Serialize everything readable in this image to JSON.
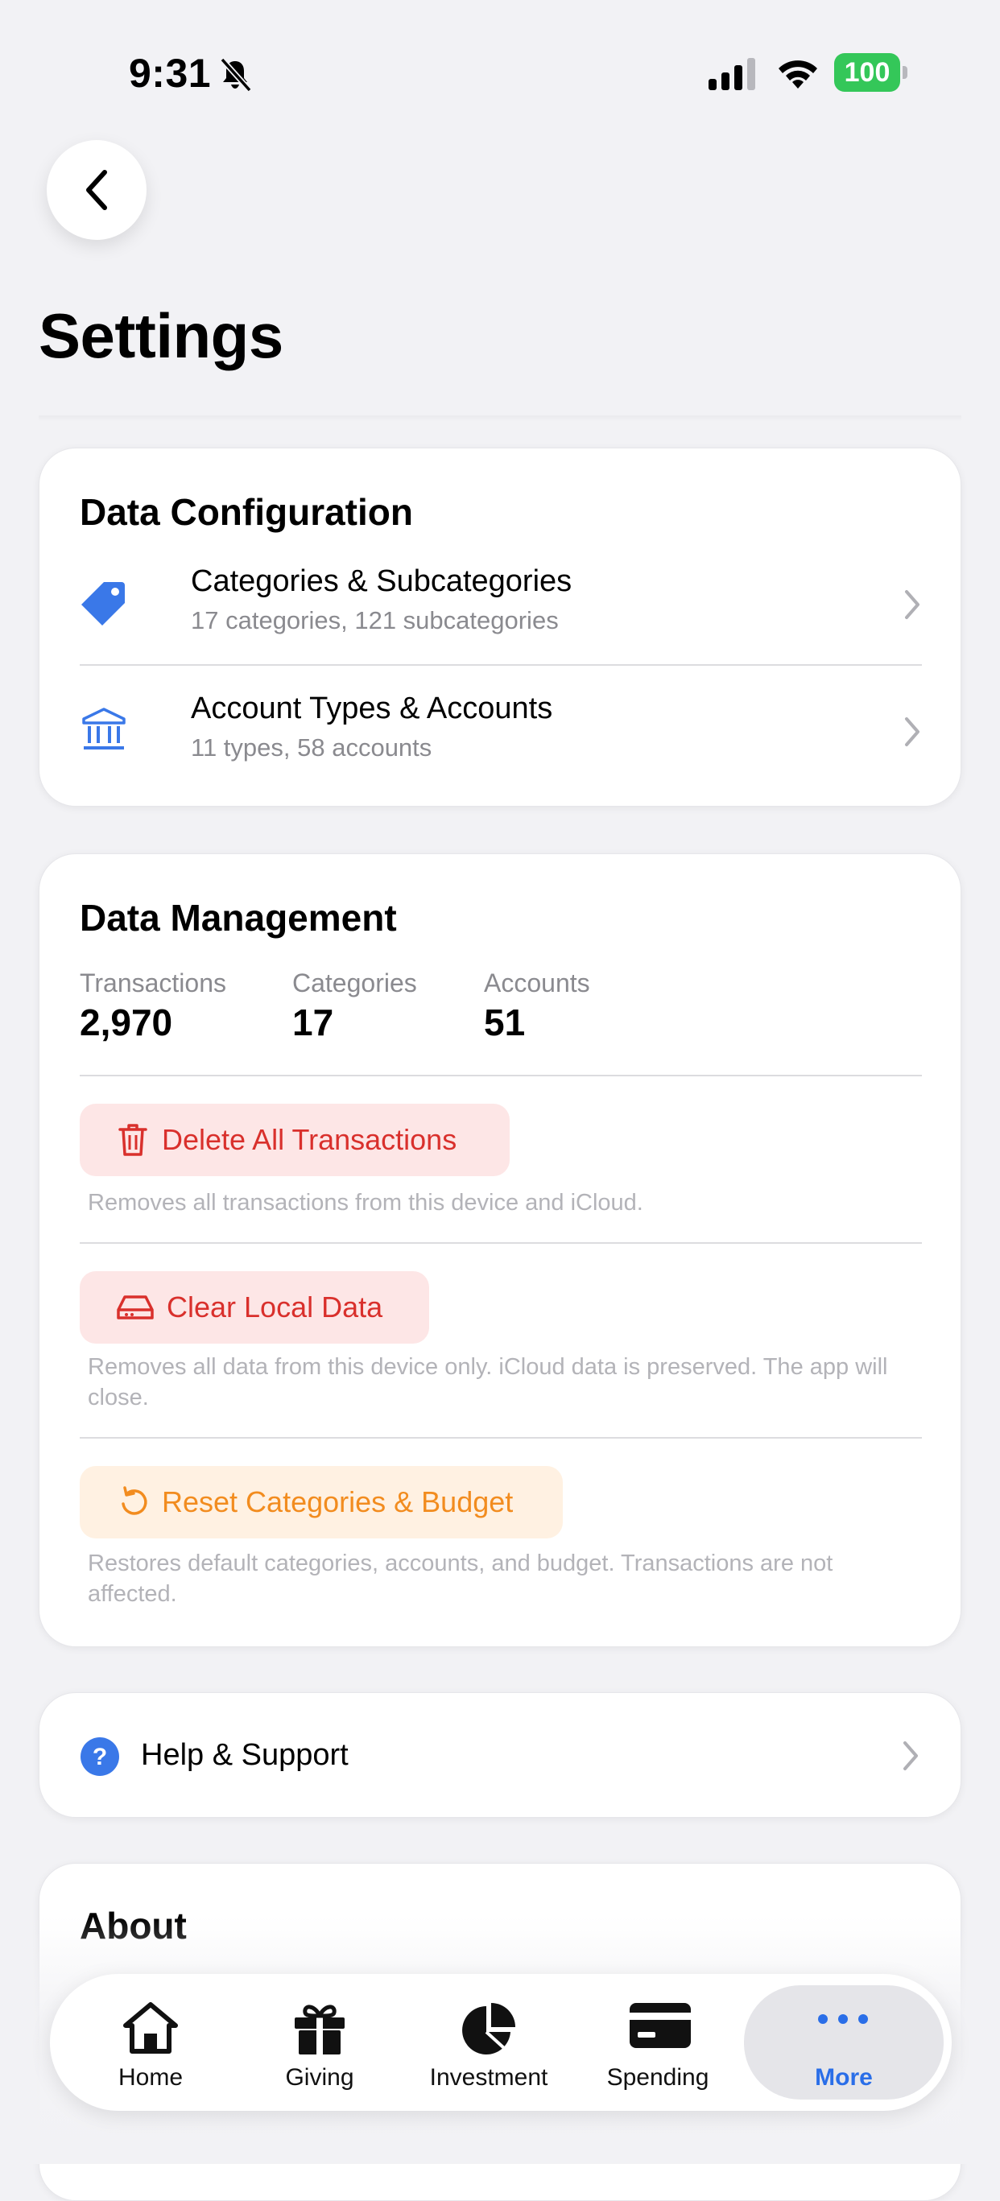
{
  "status_bar": {
    "time": "9:31",
    "battery": "100"
  },
  "page": {
    "title": "Settings"
  },
  "data_configuration": {
    "title": "Data Configuration",
    "rows": [
      {
        "icon": "tag-icon",
        "label": "Categories & Subcategories",
        "sub": "17 categories, 121 subcategories"
      },
      {
        "icon": "bank-icon",
        "label": "Account Types & Accounts",
        "sub": "11 types, 58 accounts"
      }
    ]
  },
  "data_management": {
    "title": "Data Management",
    "stats": [
      {
        "label": "Transactions",
        "value": "2,970"
      },
      {
        "label": "Categories",
        "value": "17"
      },
      {
        "label": "Accounts",
        "value": "51"
      }
    ],
    "actions": [
      {
        "icon": "trash-icon",
        "label": "Delete All Transactions",
        "note": "Removes all transactions from this device and iCloud."
      },
      {
        "icon": "drive-icon",
        "label": "Clear Local Data",
        "note": "Removes all data from this device only. iCloud data is preserved. The app will close."
      },
      {
        "icon": "reset-icon",
        "label": "Reset Categories & Budget",
        "note": "Restores default categories, accounts, and budget. Transactions are not affected."
      }
    ]
  },
  "help": {
    "icon": "question-icon",
    "label": "Help & Support"
  },
  "about": {
    "title": "About"
  },
  "tab_bar": {
    "items": [
      {
        "icon": "home-icon",
        "label": "Home"
      },
      {
        "icon": "gift-icon",
        "label": "Giving"
      },
      {
        "icon": "pie-chart-icon",
        "label": "Investment"
      },
      {
        "icon": "credit-card-icon",
        "label": "Spending"
      },
      {
        "icon": "more-icon",
        "label": "More",
        "active": true
      }
    ]
  },
  "colors": {
    "accent": "#2a6ee8",
    "destructive": "#d9302c",
    "warning": "#f28c1f",
    "battery": "#34c759"
  }
}
